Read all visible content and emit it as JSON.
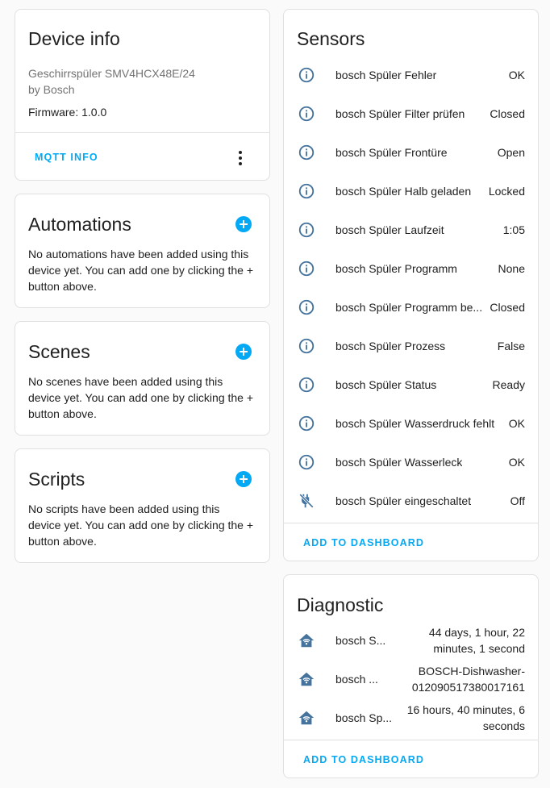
{
  "device_info": {
    "title": "Device info",
    "model": "Geschirrspüler SMV4HCX48E/24",
    "manufacturer": "by Bosch",
    "firmware": "Firmware: 1.0.0",
    "mqtt_button": "MQTT INFO"
  },
  "automations": {
    "title": "Automations",
    "text": "No automations have been added using this device yet. You can add one by clicking the + button above."
  },
  "scenes": {
    "title": "Scenes",
    "text": "No scenes have been added using this device yet. You can add one by clicking the + button above."
  },
  "scripts": {
    "title": "Scripts",
    "text": "No scripts have been added using this device yet. You can add one by clicking the + button above."
  },
  "sensors": {
    "title": "Sensors",
    "items": [
      {
        "name": "bosch Spüler Fehler",
        "state": "OK",
        "icon": "info-icon"
      },
      {
        "name": "bosch Spüler Filter prüfen",
        "state": "Closed",
        "icon": "info-icon"
      },
      {
        "name": "bosch Spüler Frontüre",
        "state": "Open",
        "icon": "info-icon"
      },
      {
        "name": "bosch Spüler Halb geladen",
        "state": "Locked",
        "icon": "info-icon"
      },
      {
        "name": "bosch Spüler Laufzeit",
        "state": "1:05",
        "icon": "info-icon"
      },
      {
        "name": "bosch Spüler Programm",
        "state": "None",
        "icon": "info-icon"
      },
      {
        "name": "bosch Spüler Programm be...",
        "state": "Closed",
        "icon": "info-icon"
      },
      {
        "name": "bosch Spüler Prozess",
        "state": "False",
        "icon": "info-icon"
      },
      {
        "name": "bosch Spüler Status",
        "state": "Ready",
        "icon": "info-icon"
      },
      {
        "name": "bosch Spüler Wasserdruck fehlt",
        "state": "OK",
        "icon": "info-icon"
      },
      {
        "name": "bosch Spüler Wasserleck",
        "state": "OK",
        "icon": "info-icon"
      },
      {
        "name": "bosch Spüler eingeschaltet",
        "state": "Off",
        "icon": "power-plug-off-icon"
      }
    ],
    "add_button": "ADD TO DASHBOARD"
  },
  "diagnostic": {
    "title": "Diagnostic",
    "items": [
      {
        "name": "bosch S...",
        "state_line1": "44 days, 1 hour, 22",
        "state_line2": "minutes, 1 second",
        "icon": "home-wifi-icon"
      },
      {
        "name": "bosch ...",
        "state_line1": "BOSCH-Dishwasher-",
        "state_line2": "012090517380017161",
        "icon": "home-wifi-icon"
      },
      {
        "name": "bosch Sp...",
        "state_line1": "16 hours, 40 minutes, 6",
        "state_line2": "seconds",
        "icon": "home-wifi-icon"
      }
    ],
    "add_button": "ADD TO DASHBOARD"
  },
  "colors": {
    "accent": "#03a9f4",
    "icon": "#44739e"
  }
}
